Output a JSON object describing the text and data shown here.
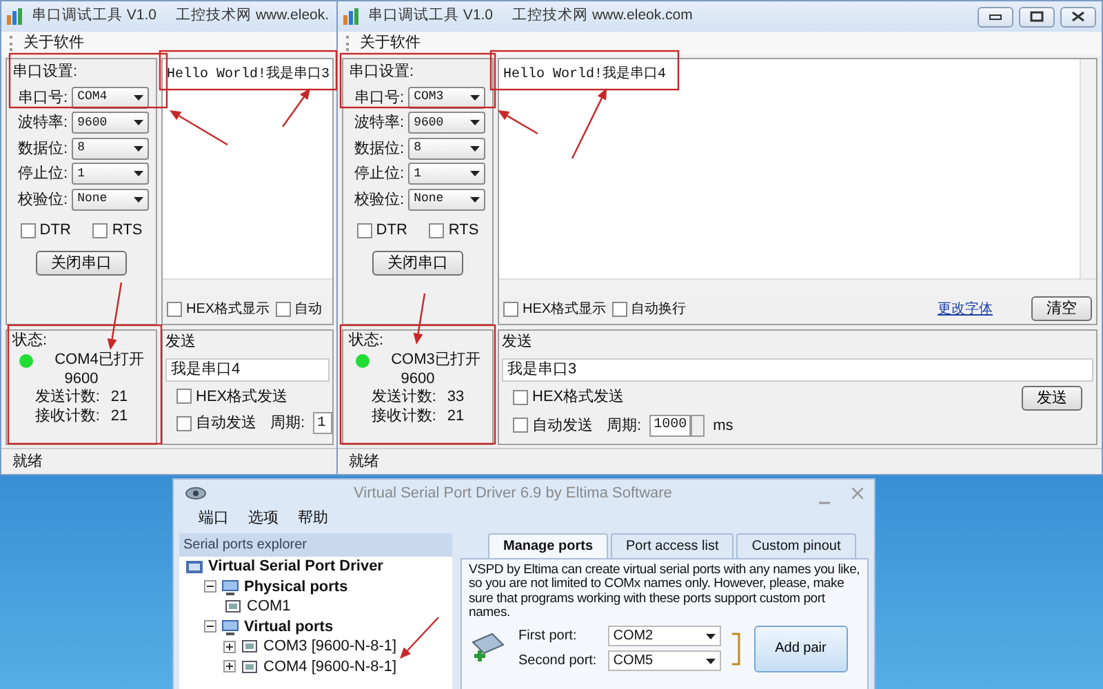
{
  "serial_windows": [
    {
      "title": "串口调试工具 V1.0",
      "subtitle": "工控技术网 www.eleok.",
      "window_buttons": false,
      "menu": [
        "关于软件"
      ],
      "settings": {
        "heading": "串口设置:",
        "fields": [
          {
            "label": "串口号:",
            "value": "COM4"
          },
          {
            "label": "波特率:",
            "value": "9600"
          },
          {
            "label": "数据位:",
            "value": "8"
          },
          {
            "label": "停止位:",
            "value": "1"
          },
          {
            "label": "校验位:",
            "value": "None"
          }
        ],
        "flags": [
          {
            "label": "DTR",
            "checked": false
          },
          {
            "label": "RTS",
            "checked": false
          }
        ],
        "button": "关闭串口"
      },
      "receive": {
        "text": "Hello World!我是串口3",
        "options": [
          {
            "label": "HEX格式显示",
            "checked": false
          },
          {
            "label": "自动",
            "checked": false
          }
        ]
      },
      "status": {
        "heading": "状态:",
        "connected": true,
        "port_state": "COM4已打开",
        "baud": "9600",
        "counters": [
          {
            "label": "发送计数:",
            "value": "21"
          },
          {
            "label": "接收计数:",
            "value": "21"
          }
        ]
      },
      "send": {
        "heading": "发送",
        "text": "我是串口4",
        "options": [
          {
            "label": "HEX格式发送",
            "checked": false
          },
          {
            "label": "自动发送",
            "checked": false
          }
        ],
        "period_label": "周期:",
        "period": "1"
      },
      "status_bar": "就绪"
    },
    {
      "title": "串口调试工具 V1.0",
      "subtitle": "工控技术网 www.eleok.com",
      "window_buttons": true,
      "menu": [
        "关于软件"
      ],
      "settings": {
        "heading": "串口设置:",
        "fields": [
          {
            "label": "串口号:",
            "value": "COM3"
          },
          {
            "label": "波特率:",
            "value": "9600"
          },
          {
            "label": "数据位:",
            "value": "8"
          },
          {
            "label": "停止位:",
            "value": "1"
          },
          {
            "label": "校验位:",
            "value": "None"
          }
        ],
        "flags": [
          {
            "label": "DTR",
            "checked": false
          },
          {
            "label": "RTS",
            "checked": false
          }
        ],
        "button": "关闭串口"
      },
      "receive": {
        "text": "Hello World!我是串口4",
        "options": [
          {
            "label": "HEX格式显示",
            "checked": false
          },
          {
            "label": "自动换行",
            "checked": false
          }
        ],
        "font_link": "更改字体",
        "clear_button": "清空"
      },
      "status": {
        "heading": "状态:",
        "connected": true,
        "port_state": "COM3已打开",
        "baud": "9600",
        "counters": [
          {
            "label": "发送计数:",
            "value": "33"
          },
          {
            "label": "接收计数:",
            "value": "21"
          }
        ]
      },
      "send": {
        "heading": "发送",
        "text": "我是串口3",
        "options": [
          {
            "label": "HEX格式发送",
            "checked": false
          },
          {
            "label": "自动发送",
            "checked": false
          }
        ],
        "period_label": "周期:",
        "period": "1000",
        "unit": "ms",
        "send_button": "发送"
      },
      "status_bar": "就绪"
    }
  ],
  "vspd_window": {
    "title": "Virtual Serial Port Driver 6.9 by Eltima Software",
    "menu": [
      "端口",
      "选项",
      "帮助"
    ],
    "explorer": {
      "heading": "Serial ports explorer",
      "tree": [
        {
          "label": "Virtual Serial Port Driver",
          "children": [
            {
              "label": "Physical ports",
              "expanded": true,
              "children": [
                {
                  "label": "COM1"
                }
              ]
            },
            {
              "label": "Virtual ports",
              "expanded": true,
              "children": [
                {
                  "label": "COM3 [9600-N-8-1]",
                  "expanded": false
                },
                {
                  "label": "COM4 [9600-N-8-1]",
                  "expanded": false
                }
              ]
            }
          ]
        }
      ]
    },
    "tabs": [
      {
        "label": "Manage ports",
        "selected": true
      },
      {
        "label": "Port access list",
        "selected": false
      },
      {
        "label": "Custom pinout",
        "selected": false
      }
    ],
    "description": "VSPD by Eltima can create virtual serial ports with any names you like, so you are not limited to COMx names only. However, please, make sure that programs working with these ports support custom port names.",
    "ports": [
      {
        "label": "First port:",
        "value": "COM2"
      },
      {
        "label": "Second port:",
        "value": "COM5"
      }
    ],
    "add_button": "Add pair"
  }
}
